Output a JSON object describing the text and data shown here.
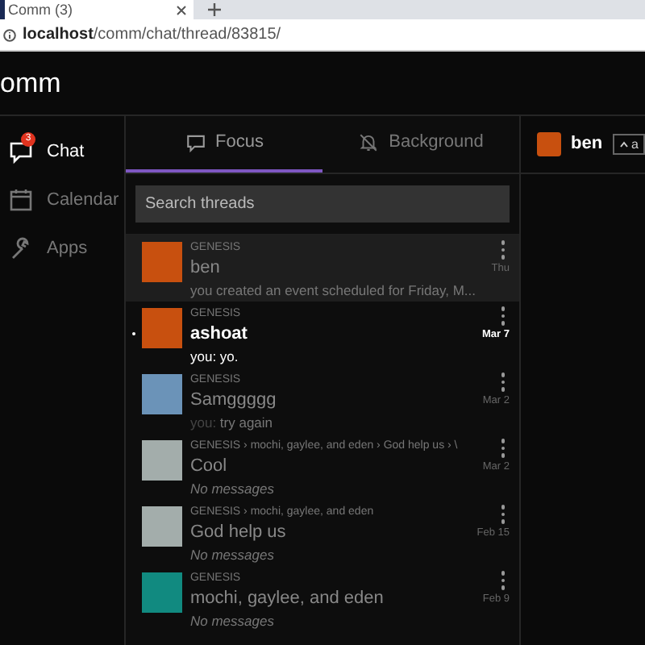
{
  "browser": {
    "tab_title": "Comm (3)",
    "url_host": "localhost",
    "url_path": "/comm/chat/thread/83815/"
  },
  "app": {
    "title": "omm"
  },
  "nav": [
    {
      "label": "Chat",
      "selected": true,
      "badge": "3"
    },
    {
      "label": "Calendar",
      "selected": false
    },
    {
      "label": "Apps",
      "selected": false
    }
  ],
  "tabs": [
    {
      "label": "Focus",
      "selected": true
    },
    {
      "label": "Background",
      "selected": false
    }
  ],
  "search": {
    "placeholder": "Search threads"
  },
  "threads": [
    {
      "ancestry": "GENESIS",
      "name": "ben",
      "preview": "you created an event scheduled for Friday, M...",
      "empty": false,
      "time": "Thu",
      "color": "#c8500f",
      "selected": true,
      "unread": false
    },
    {
      "ancestry": "GENESIS",
      "name": "ashoat",
      "preview_author": "you:",
      "preview": " yo.",
      "empty": false,
      "time": "Mar 7",
      "color": "#c8500f",
      "selected": false,
      "unread": true
    },
    {
      "ancestry": "GENESIS",
      "name": "Samggggg",
      "preview_author": "you:",
      "preview": " try again",
      "empty": false,
      "time": "Mar 2",
      "color": "#6b93b8",
      "selected": false,
      "unread": false
    },
    {
      "ancestry": "GENESIS › mochi, gaylee, and eden › God help us › \\",
      "name": "Cool",
      "preview": "No messages",
      "empty": true,
      "time": "Mar 2",
      "color": "#a3adab",
      "selected": false,
      "unread": false
    },
    {
      "ancestry": "GENESIS › mochi, gaylee, and eden",
      "name": "God help us",
      "preview": "No messages",
      "empty": true,
      "time": "Feb 15",
      "color": "#a3adab",
      "selected": false,
      "unread": false
    },
    {
      "ancestry": "GENESIS",
      "name": "mochi, gaylee, and eden",
      "preview": "No messages",
      "empty": true,
      "time": "Feb 9",
      "color": "#118a80",
      "selected": false,
      "unread": false
    }
  ],
  "conversation": {
    "name": "ben",
    "color": "#c8500f",
    "button_label": "a"
  }
}
